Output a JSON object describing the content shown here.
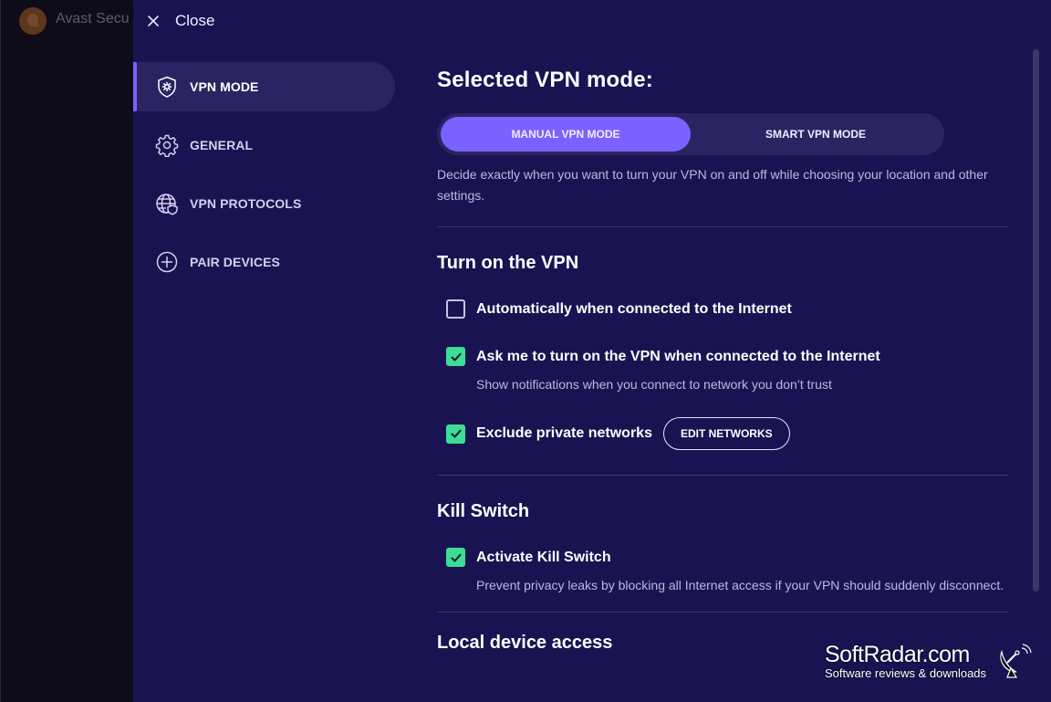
{
  "background_app": {
    "title": "Avast Secu"
  },
  "header": {
    "close_label": "Close"
  },
  "sidebar": {
    "items": [
      {
        "label": "VPN MODE",
        "icon": "shield-gear-icon",
        "active": true
      },
      {
        "label": "GENERAL",
        "icon": "gear-icon",
        "active": false
      },
      {
        "label": "VPN PROTOCOLS",
        "icon": "globe-shield-icon",
        "active": false
      },
      {
        "label": "PAIR DEVICES",
        "icon": "plus-circle-icon",
        "active": false
      }
    ]
  },
  "main": {
    "title": "Selected VPN mode:",
    "mode_toggle": {
      "options": [
        "MANUAL VPN MODE",
        "SMART VPN MODE"
      ],
      "selected": "MANUAL VPN MODE"
    },
    "mode_description": "Decide exactly when you want to turn your VPN on and off while choosing your location and other settings.",
    "sections": {
      "turn_on": {
        "title": "Turn on the VPN",
        "options": [
          {
            "label": "Automatically when connected to the Internet",
            "checked": false
          },
          {
            "label": "Ask me to turn on the VPN when connected to the Internet",
            "checked": true,
            "description": "Show notifications when you connect to network you don’t trust"
          },
          {
            "label": "Exclude private networks",
            "checked": true,
            "button": "EDIT NETWORKS"
          }
        ]
      },
      "kill_switch": {
        "title": "Kill Switch",
        "options": [
          {
            "label": "Activate Kill Switch",
            "checked": true,
            "description": "Prevent privacy leaks by blocking all Internet access if your VPN should suddenly disconnect."
          }
        ]
      },
      "local_access": {
        "title": "Local device access"
      }
    }
  },
  "watermark": {
    "title": "SoftRadar.com",
    "subtitle": "Software reviews & downloads"
  },
  "colors": {
    "accent": "#7b61ff",
    "check": "#3ddc97",
    "panel": "#1a1352",
    "active_nav": "#2b2462"
  }
}
